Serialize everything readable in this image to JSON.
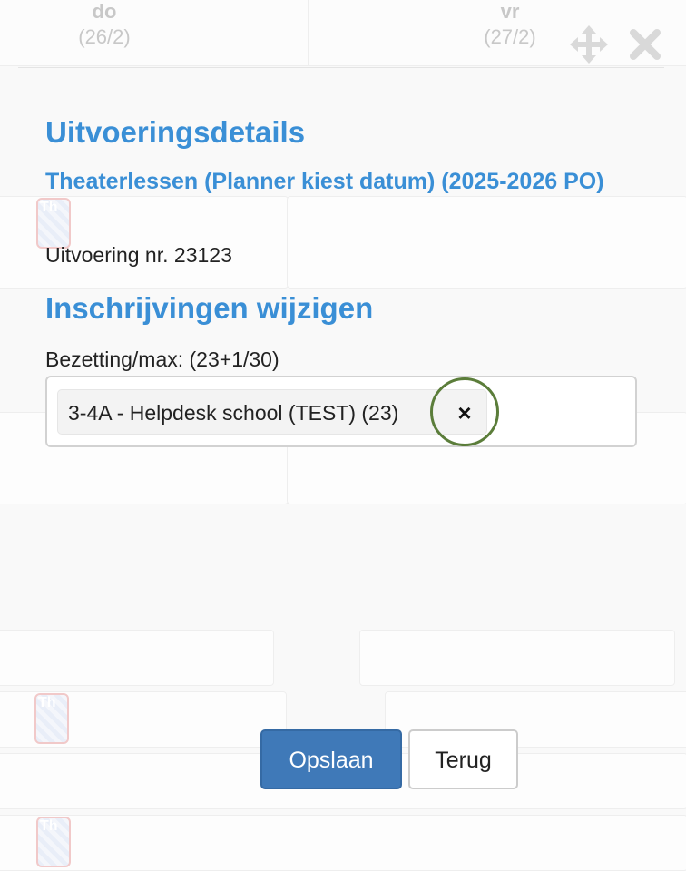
{
  "calendar": {
    "days": [
      {
        "name": "do",
        "date": "(26/2)"
      },
      {
        "name": "vr",
        "date": "(27/2)"
      }
    ],
    "event_label": "Th"
  },
  "toolbar": {
    "move_icon": "move-arrows-icon",
    "close_icon": "close-icon"
  },
  "modal": {
    "title": "Uitvoeringsdetails",
    "subtitle": "Theaterlessen (Planner kiest datum) (2025-2026 PO)",
    "performance_number": "Uitvoering nr. 23123",
    "edit_heading": "Inschrijvingen wijzigen",
    "occupancy_label": "Bezetting/max: (23+1/30)",
    "selected_tags": [
      {
        "label": "3-4A - Helpdesk school (TEST) (23)",
        "remove_label": "×"
      }
    ],
    "save_label": "Opslaan",
    "back_label": "Terug"
  },
  "colors": {
    "heading": "#3a8fd6",
    "primary_button": "#3f79b8",
    "focus_ring": "#5b7d3a"
  }
}
